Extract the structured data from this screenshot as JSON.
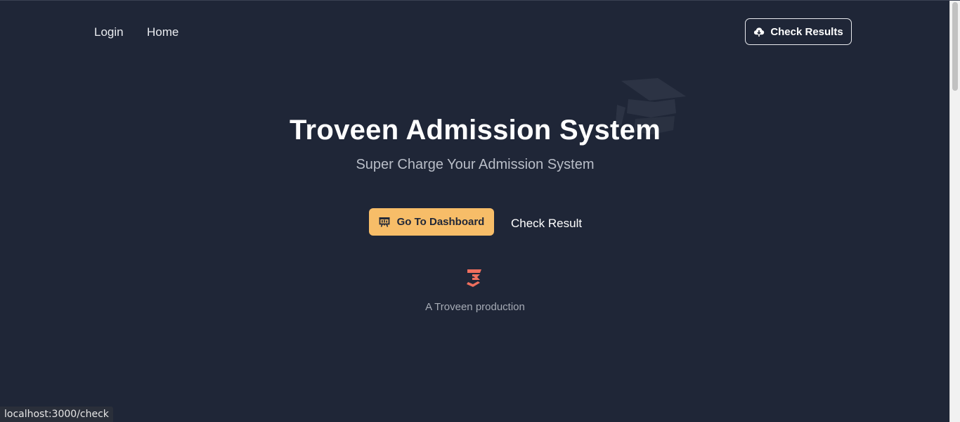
{
  "nav": {
    "login_label": "Login",
    "home_label": "Home",
    "check_results_label": "Check Results",
    "check_results_icon": "cloud-download-icon"
  },
  "hero": {
    "title": "Troveen Admission System",
    "subtitle": "Super Charge Your Admission System",
    "watermark_icon": "graduation-cap-icon"
  },
  "actions": {
    "dashboard_label": "Go To Dashboard",
    "dashboard_icon": "presentation-board-icon",
    "check_result_label": "Check Result"
  },
  "footer": {
    "logo_icon": "troveen-logo-icon",
    "production_text": "A Troveen production"
  },
  "status_bar": {
    "url": "localhost:3000/check"
  },
  "colors": {
    "background": "#1f2637",
    "accent": "#f7bd68",
    "logo": "#ef6f5e",
    "text_primary": "#ffffff",
    "text_muted": "#b9bec8"
  }
}
